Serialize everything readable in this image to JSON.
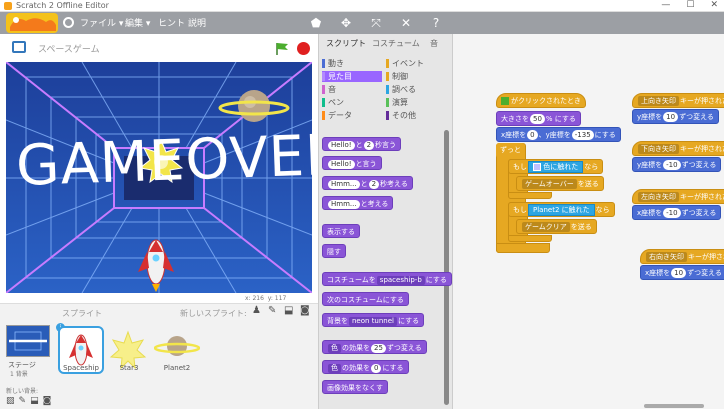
{
  "window": {
    "title": "Scratch 2 Offline Editor",
    "controls": [
      "—",
      "☐",
      "✕"
    ]
  },
  "menubar": {
    "menus": [
      "ファイル ▾",
      "編集 ▾",
      "ヒント",
      "説明"
    ]
  },
  "project": {
    "title": "スペースゲーム"
  },
  "stage": {
    "text": "GAMEOVER"
  },
  "coords": {
    "x_label": "x: 216",
    "y_label": "y: 117"
  },
  "sprites_pane": {
    "label": "スプライト",
    "new_sprite_label": "新しいスプライト:",
    "stage_label": "ステージ",
    "stage_sub": "1 背景",
    "new_backdrop": "新しい背景:",
    "sprites": [
      {
        "name": "Spaceship",
        "selected": true
      },
      {
        "name": "Star3",
        "selected": false
      },
      {
        "name": "Planet2",
        "selected": false
      }
    ]
  },
  "palette": {
    "tabs": [
      "スクリプト",
      "コスチューム",
      "音"
    ],
    "categories_left": [
      "動き",
      "見た目",
      "音",
      "ペン",
      "データ"
    ],
    "categories_right": [
      "イベント",
      "制御",
      "調べる",
      "演算",
      "その他"
    ],
    "blocks": [
      {
        "text": "Hello! と 2 秒言う",
        "parts": [
          "Hello!",
          "と",
          "2",
          "秒言う"
        ]
      },
      {
        "text": "Hello! と言う",
        "parts": [
          "Hello!",
          "と言う"
        ]
      },
      {
        "text": "Hmm... と 2 秒考える",
        "parts": [
          "Hmm...",
          "と",
          "2",
          "秒考える"
        ]
      },
      {
        "text": "Hmm... と考える",
        "parts": [
          "Hmm...",
          "と考える"
        ]
      },
      {
        "text": "表示する"
      },
      {
        "text": "隠す"
      },
      {
        "text": "コスチュームを spaceship-b にする",
        "parts": [
          "コスチュームを",
          "spaceship-b",
          "にする"
        ]
      },
      {
        "text": "次のコスチュームにする"
      },
      {
        "text": "背景を neon tunnel にする",
        "parts": [
          "背景を",
          "neon tunnel",
          "にする"
        ]
      },
      {
        "text": "色 の効果を 25 ずつ変える",
        "parts": [
          "色",
          "の効果を",
          "25",
          "ずつ変える"
        ]
      },
      {
        "text": "色 の効果を 0 にする",
        "parts": [
          "色",
          "の効果を",
          "0",
          "にする"
        ]
      },
      {
        "text": "画像効果をなくす"
      }
    ]
  },
  "scripts": {
    "main": {
      "hat": "がクリックされたとき",
      "size": [
        "大きさを",
        "50",
        "% にする"
      ],
      "goto": [
        "x座標を",
        "0",
        "、y座標を",
        "-135",
        "にする"
      ],
      "forever": "ずっと",
      "if1": [
        "もし",
        "色に触れた",
        "なら"
      ],
      "say1": [
        "ゲームオーバー",
        "を送る"
      ],
      "if2": [
        "もし",
        "Planet2",
        "に触れた",
        "なら"
      ],
      "say2": [
        "ゲームクリア",
        "を送る"
      ]
    },
    "key_up": {
      "hat": [
        "上向き矢印",
        "キーが押されたとき"
      ],
      "body": [
        "y座標を",
        "10",
        "ずつ変える"
      ]
    },
    "key_down": {
      "hat": [
        "下向き矢印",
        "キーが押されたとき"
      ],
      "body": [
        "y座標を",
        "-10",
        "ずつ変える"
      ]
    },
    "key_left": {
      "hat": [
        "左向き矢印",
        "キーが押されたとき"
      ],
      "body": [
        "x座標を",
        "-10",
        "ずつ変える"
      ]
    },
    "key_right": {
      "hat": [
        "右向き矢印",
        "キーが押されたとき"
      ],
      "body": [
        "x座標を",
        "10",
        "ずつ変える"
      ]
    }
  },
  "colors": {
    "menubar": "#9c9fa4",
    "looks": "#8a55d7",
    "events": "#e6a822",
    "motion": "#4a6cd4",
    "sensing": "#2ca5e2"
  }
}
